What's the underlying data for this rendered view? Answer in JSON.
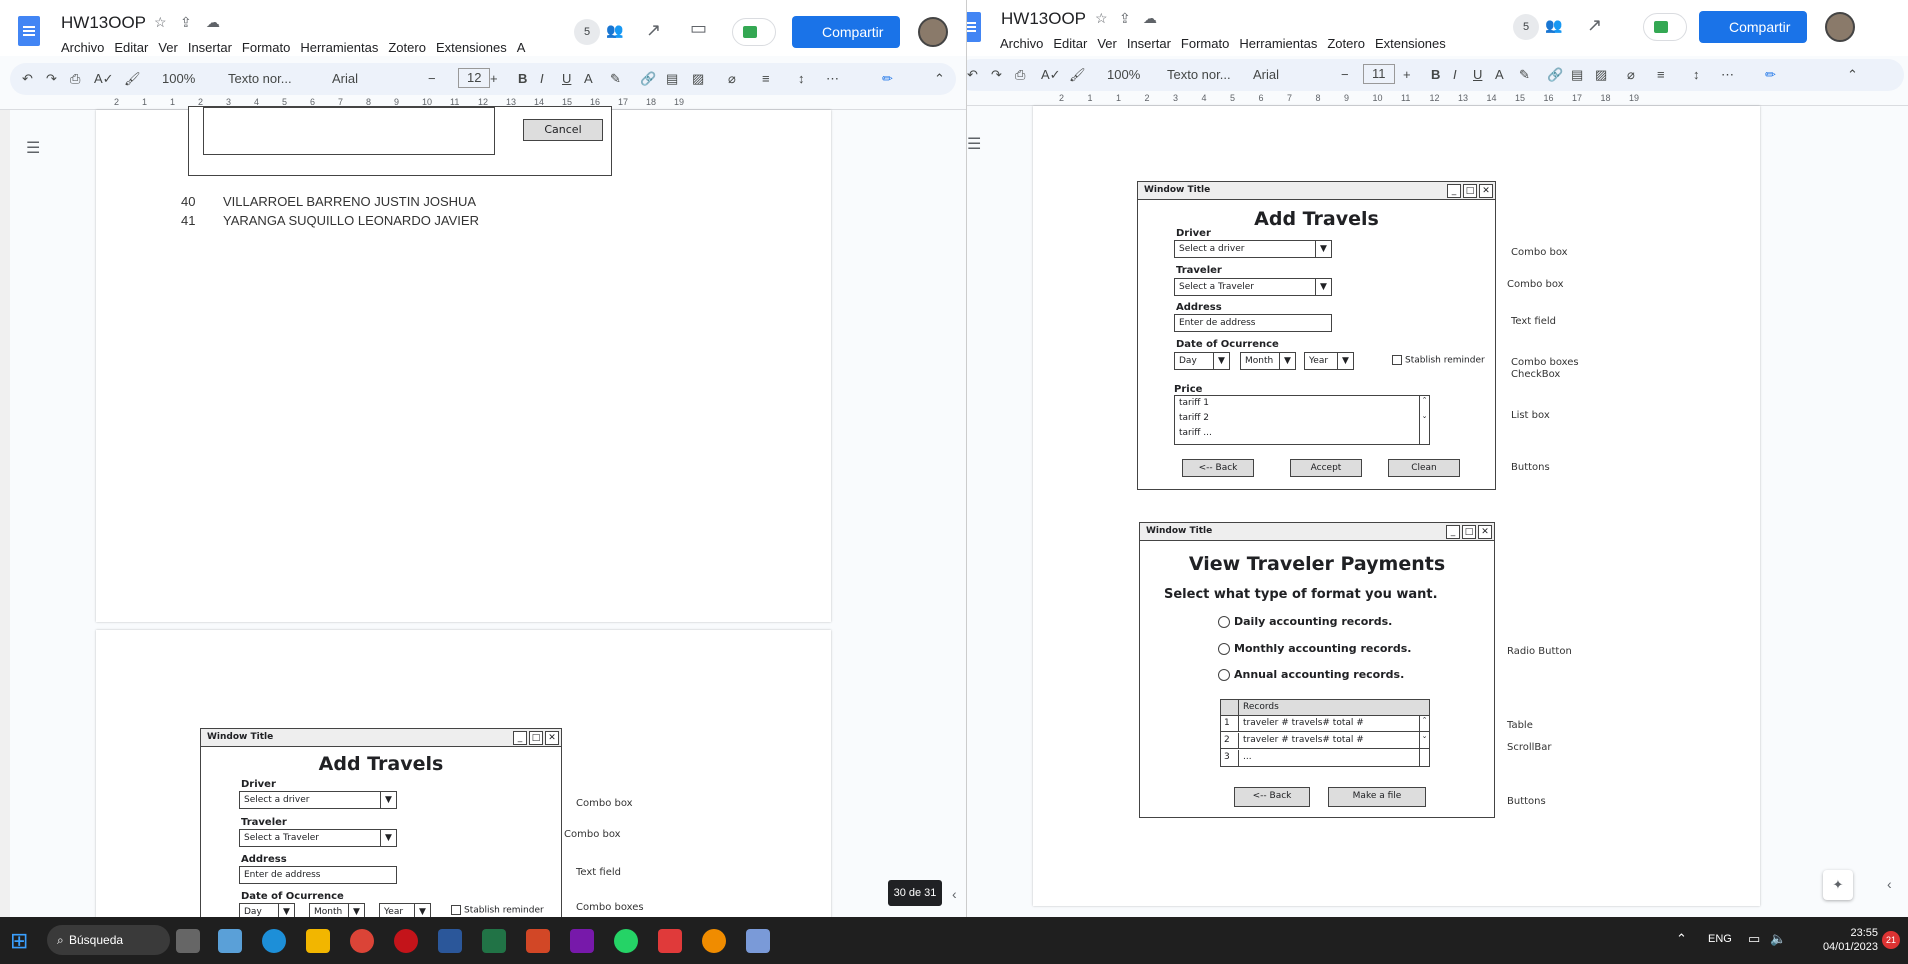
{
  "left": {
    "doc_title": "HW13OOP",
    "menu": [
      "Archivo",
      "Editar",
      "Ver",
      "Insertar",
      "Formato",
      "Herramientas",
      "Zotero",
      "Extensiones",
      "A"
    ],
    "collab_count": "5",
    "share_label": "Compartir",
    "zoom": "100%",
    "style": "Texto nor...",
    "font": "Arial",
    "font_size": "12",
    "ruler": [
      "2",
      "1",
      "1",
      "2",
      "3",
      "4",
      "5",
      "6",
      "7",
      "8",
      "9",
      "10",
      "11",
      "12",
      "13",
      "14",
      "15",
      "16",
      "17",
      "18",
      "19"
    ],
    "cancel_label": "Cancel",
    "rows": [
      {
        "num": "40",
        "name": "VILLARROEL BARRENO JUSTIN JOSHUA"
      },
      {
        "num": "41",
        "name": "YARANGA SUQUILLO LEONARDO JAVIER"
      }
    ],
    "page_indicator": "30 de 31"
  },
  "right": {
    "doc_title": "HW13OOP",
    "menu": [
      "Archivo",
      "Editar",
      "Ver",
      "Insertar",
      "Formato",
      "Herramientas",
      "Zotero",
      "Extensiones",
      "A"
    ],
    "collab_count": "5",
    "share_label": "Compartir",
    "zoom": "100%",
    "style": "Texto nor...",
    "font": "Arial",
    "font_size": "11",
    "ruler": [
      "2",
      "1",
      "1",
      "2",
      "3",
      "4",
      "5",
      "6",
      "7",
      "8",
      "9",
      "10",
      "11",
      "12",
      "13",
      "14",
      "15",
      "16",
      "17",
      "18",
      "19"
    ]
  },
  "add_travels": {
    "window_title": "Window Title",
    "heading": "Add Travels",
    "driver_label": "Driver",
    "driver_value": "Select a driver",
    "traveler_label": "Traveler",
    "traveler_value": "Select a Traveler",
    "address_label": "Address",
    "address_value": "Enter de address",
    "date_label": "Date of Ocurrence",
    "day": "Day",
    "month": "Month",
    "year": "Year",
    "reminder": "Stablish reminder",
    "price_label": "Price",
    "tariffs": [
      "tariff 1",
      "tariff 2",
      "tariff ..."
    ],
    "back": "<-- Back",
    "accept": "Accept",
    "clean": "Clean",
    "notes": {
      "combo1": "Combo box",
      "combo2": "Combo box",
      "text": "Text field",
      "combos": "Combo boxes",
      "check": "CheckBox",
      "list": "List box",
      "buttons": "Buttons"
    }
  },
  "payments": {
    "window_title": "Window Title",
    "heading": "View Traveler Payments",
    "subheading": "Select what type of format you want.",
    "options": [
      "Daily accounting records.",
      "Monthly accounting records.",
      "Annual accounting records."
    ],
    "table_header": "Records",
    "table_rows": [
      {
        "n": "1",
        "v": "traveler # travels# total #"
      },
      {
        "n": "2",
        "v": "traveler # travels# total #"
      },
      {
        "n": "3",
        "v": "..."
      }
    ],
    "back": "<-- Back",
    "make_file": "Make a file",
    "notes": {
      "radio": "Radio Button",
      "table": "Table",
      "scroll": "ScrollBar",
      "buttons": "Buttons"
    }
  },
  "taskbar": {
    "search": "Búsqueda",
    "lang": "ENG",
    "time": "23:55",
    "date": "04/01/2023",
    "badge": "21"
  }
}
